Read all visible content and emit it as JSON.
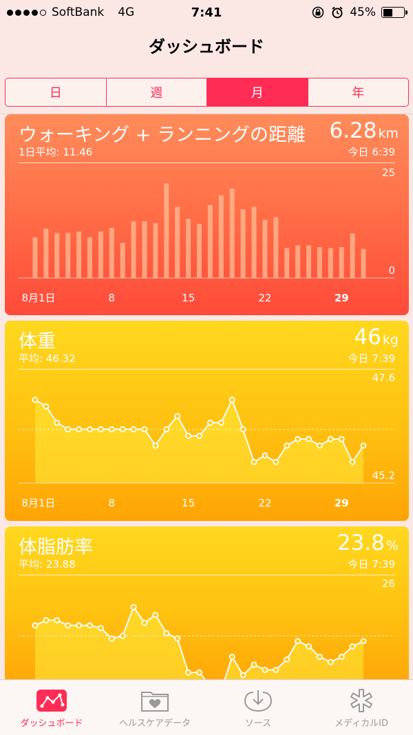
{
  "status_bar": {
    "carrier": "SoftBank",
    "network": "4G",
    "time": "7:41",
    "battery": "45%",
    "battery_level": 0.45
  },
  "nav": {
    "title": "ダッシュボード"
  },
  "segment": {
    "items": [
      "日",
      "週",
      "月",
      "年"
    ],
    "selected": "月"
  },
  "cards": [
    {
      "title": "ウォーキング + ランニングの距離",
      "value": "6.28",
      "unit": "km",
      "avg": "1日平均: 11.46",
      "date": "今日 6:39",
      "color": "#ff5a3c"
    },
    {
      "title": "体重",
      "value": "46",
      "unit": "kg",
      "avg": "平均: 46.32",
      "date": "今日 7:39",
      "color": "#ffc010"
    },
    {
      "title": "体脂肪率",
      "value": "23.8",
      "unit": "%",
      "avg": "平均: 23.88",
      "date": "今日 7:39",
      "color": "#ffc010"
    }
  ],
  "chart_data": [
    {
      "type": "bar",
      "title": "ウォーキング + ランニングの距離",
      "x_tick_labels": [
        "8月1日",
        "8",
        "15",
        "22",
        "29"
      ],
      "ylim": [
        0,
        25
      ],
      "y_tick_labels": [
        "25",
        "0"
      ],
      "values": [
        9.5,
        11.5,
        10.5,
        10.5,
        10.8,
        9.5,
        10.8,
        11.7,
        8.2,
        13.2,
        13.2,
        12.8,
        22,
        16.6,
        13.8,
        12.6,
        17,
        19.3,
        20.8,
        16,
        16.6,
        13.6,
        14.2,
        7,
        7.6,
        7.6,
        7.2,
        7,
        7.2,
        10.4,
        6.8
      ]
    },
    {
      "type": "line",
      "title": "体重",
      "x_tick_labels": [
        "8月1日",
        "8",
        "15",
        "22",
        "29"
      ],
      "ylim": [
        45.2,
        47.6
      ],
      "y_tick_labels": [
        "47.6",
        "45.2"
      ],
      "values": [
        47.2,
        47.0,
        46.5,
        46.3,
        46.3,
        46.3,
        46.3,
        46.3,
        46.3,
        46.3,
        46.3,
        45.8,
        46.3,
        46.7,
        46.1,
        46.1,
        46.5,
        46.5,
        47.2,
        46.3,
        45.3,
        45.5,
        45.3,
        45.8,
        46.0,
        46.0,
        45.8,
        46.0,
        46.0,
        45.3,
        45.8
      ]
    },
    {
      "type": "line",
      "title": "体脂肪率",
      "x_tick_labels": [],
      "ylim": [
        22,
        26
      ],
      "y_tick_labels": [
        "26"
      ],
      "values": [
        24.4,
        24.6,
        24.6,
        24.4,
        24.4,
        24.4,
        24.3,
        23.9,
        24.0,
        25.1,
        24.5,
        24.8,
        24.1,
        23.9,
        22.6,
        22.6,
        22.1,
        21.9,
        23.2,
        22.5,
        22.9,
        22.7,
        22.7,
        23.1,
        23.8,
        23.6,
        23.2,
        23.0,
        23.2,
        23.6,
        23.8
      ]
    }
  ],
  "tab_bar": {
    "items": [
      {
        "label": "ダッシュボード",
        "icon": "dashboard-icon",
        "active": true
      },
      {
        "label": "ヘルスケアデータ",
        "icon": "health-data-icon",
        "active": false
      },
      {
        "label": "ソース",
        "icon": "sources-icon",
        "active": false
      },
      {
        "label": "メディカルID",
        "icon": "medical-id-icon",
        "active": false
      }
    ]
  }
}
